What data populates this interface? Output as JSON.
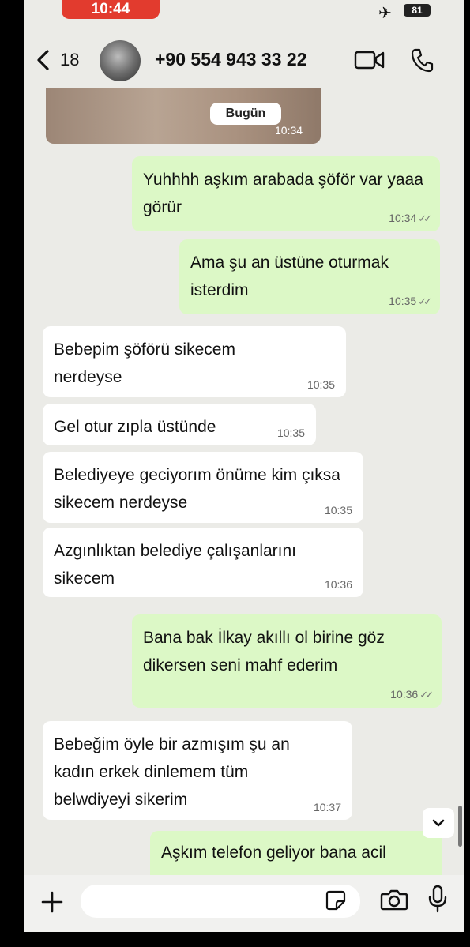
{
  "status": {
    "time": "10:44",
    "battery": "81"
  },
  "header": {
    "back_count": "18",
    "contact": "+90 554 943 33 22"
  },
  "image_message": {
    "date_chip": "Bugün",
    "time": "10:34"
  },
  "messages": [
    {
      "text": "Yuhhhh aşkım arabada şöför var yaaa görür",
      "time": "10:34"
    },
    {
      "text": "Ama şu an üstüne oturmak isterdim",
      "time": "10:35"
    },
    {
      "text": "Bebepim şöförü sikecem nerdeyse",
      "time": "10:35"
    },
    {
      "text": "Gel otur zıpla üstünde",
      "time": "10:35"
    },
    {
      "text": "Belediyeye geciyorım önüme kim çıksa sikecem nerdeyse",
      "time": "10:35"
    },
    {
      "text": "Azgınlıktan belediye çalışanlarını sikecem",
      "time": "10:36"
    },
    {
      "text": "Bana bak İlkay akıllı ol birine göz dikersen seni mahf ederim",
      "time": "10:36"
    },
    {
      "text": "Bebeğim öyle bir azmışım şu an kadın erkek dinlemem tüm belwdiyeyi sikerim",
      "time": "10:37"
    },
    {
      "text": "Aşkım telefon geliyor bana acil",
      "time": ""
    }
  ],
  "tick": "✓✓",
  "input": {
    "placeholder": ""
  }
}
